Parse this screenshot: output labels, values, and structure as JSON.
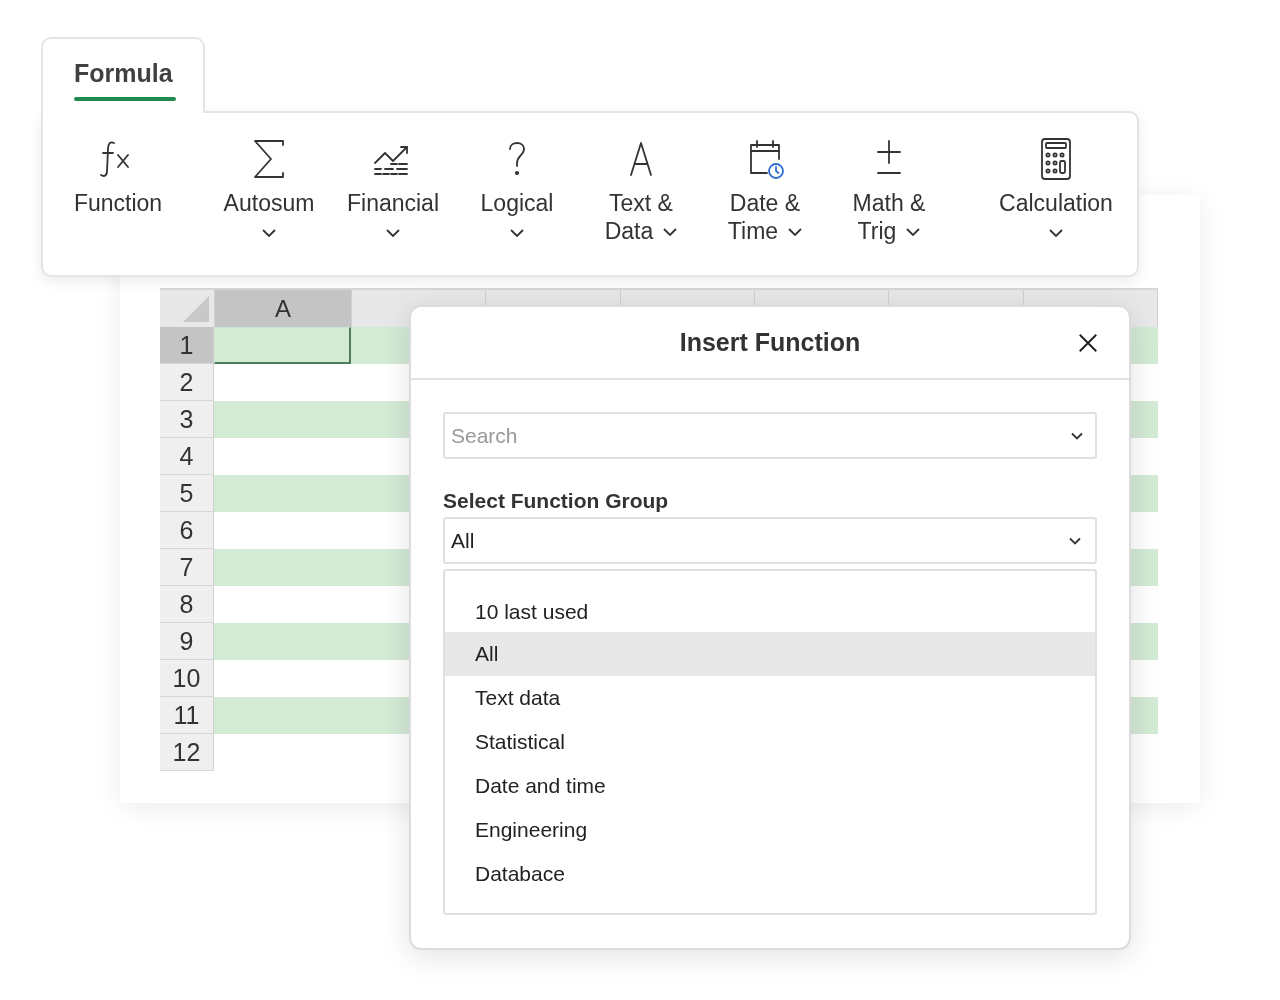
{
  "ribbon": {
    "tab": {
      "label": "Formula",
      "selected": true
    },
    "groups": [
      {
        "items": [
          {
            "kind": "fx",
            "lines": [
              "Function"
            ],
            "dropdown": false
          }
        ]
      },
      {
        "items": [
          {
            "kind": "sum",
            "lines": [
              "Autosum"
            ],
            "dropdown": true
          },
          {
            "kind": "chart",
            "lines": [
              "Financial"
            ],
            "dropdown": true
          },
          {
            "kind": "question",
            "lines": [
              "Logical"
            ],
            "dropdown": true
          },
          {
            "kind": "letter",
            "lines": [
              "Text &",
              "Data"
            ],
            "dropdown": true
          },
          {
            "kind": "calendar",
            "lines": [
              "Date &",
              "Time"
            ],
            "dropdown": true
          },
          {
            "kind": "plusminus",
            "lines": [
              "Math &",
              "Trig"
            ],
            "dropdown": true
          }
        ]
      },
      {
        "items": [
          {
            "kind": "calculator",
            "lines": [
              "Calculation"
            ],
            "dropdown": true
          }
        ]
      }
    ]
  },
  "sheet": {
    "columns": [
      {
        "label": "A",
        "selected": true
      }
    ],
    "rows": [
      {
        "label": "1",
        "selected": true,
        "shaded": true
      },
      {
        "label": "2",
        "selected": false,
        "shaded": false
      },
      {
        "label": "3",
        "selected": false,
        "shaded": true
      },
      {
        "label": "4",
        "selected": false,
        "shaded": false
      },
      {
        "label": "5",
        "selected": false,
        "shaded": true
      },
      {
        "label": "6",
        "selected": false,
        "shaded": false
      },
      {
        "label": "7",
        "selected": false,
        "shaded": true
      },
      {
        "label": "8",
        "selected": false,
        "shaded": false
      },
      {
        "label": "9",
        "selected": false,
        "shaded": true
      },
      {
        "label": "10",
        "selected": false,
        "shaded": false
      },
      {
        "label": "11",
        "selected": false,
        "shaded": true
      },
      {
        "label": "12",
        "selected": false,
        "shaded": false
      }
    ]
  },
  "dialog": {
    "title": "Insert Function",
    "search": {
      "placeholder": "Search"
    },
    "group_label": "Select Function Group",
    "group_value": "All",
    "options": [
      {
        "label": "10 last used",
        "selected": false
      },
      {
        "label": "All",
        "selected": true
      },
      {
        "label": "Text data",
        "selected": false
      },
      {
        "label": "Statistical",
        "selected": false
      },
      {
        "label": "Date and time",
        "selected": false
      },
      {
        "label": "Engineering",
        "selected": false
      },
      {
        "label": "Databace",
        "selected": false
      }
    ]
  }
}
